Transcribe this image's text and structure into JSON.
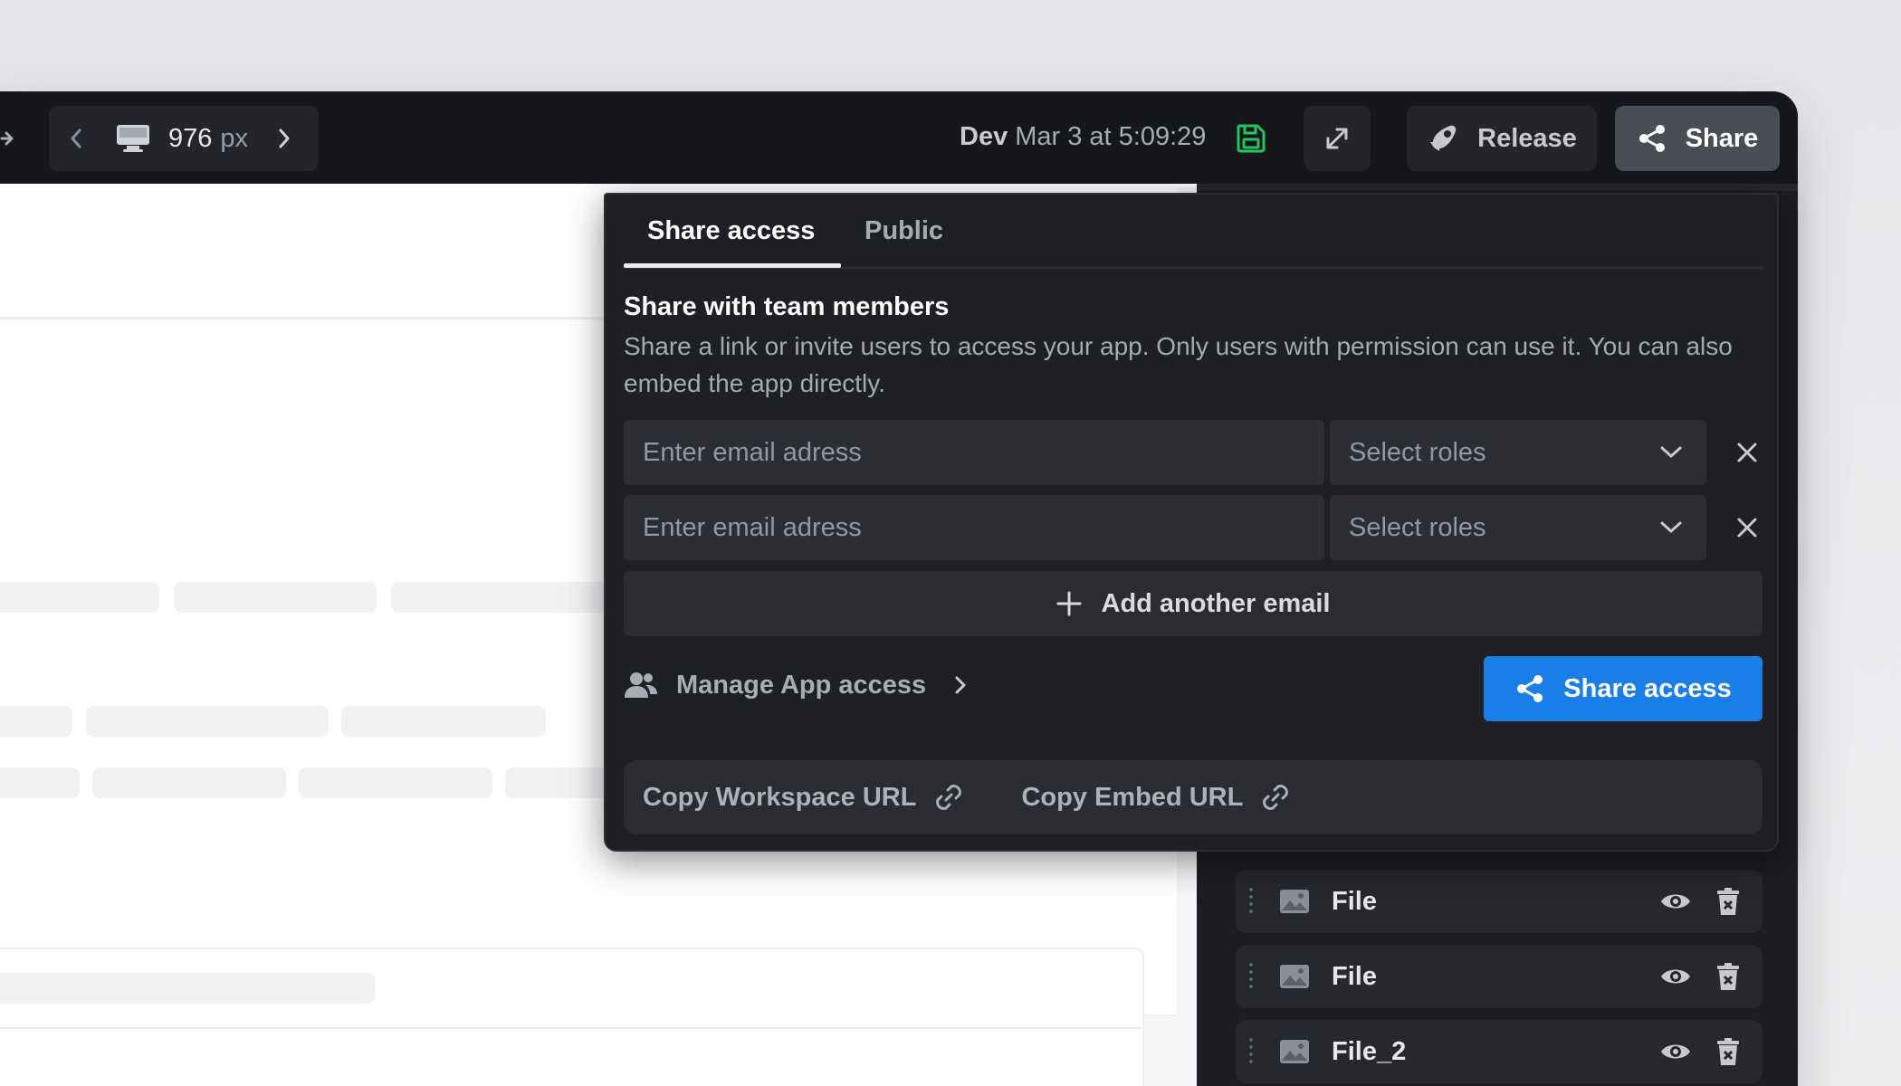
{
  "topbar": {
    "viewport_width_value": "976",
    "viewport_width_unit": "px",
    "env_label": "Dev",
    "saved_time": "Mar 3 at 5:09:29",
    "release_label": "Release",
    "share_label": "Share"
  },
  "share_popover": {
    "tabs": [
      {
        "label": "Share access",
        "active": true
      },
      {
        "label": "Public",
        "active": false
      }
    ],
    "section_title": "Share with team members",
    "section_desc": "Share a link or invite users to access your app. Only users with permission can use it. You can also embed the app directly.",
    "invite_rows": [
      {
        "email_placeholder": "Enter email adress",
        "role_placeholder": "Select roles"
      },
      {
        "email_placeholder": "Enter email adress",
        "role_placeholder": "Select roles"
      }
    ],
    "add_email_label": "Add another email",
    "manage_access_label": "Manage App access",
    "share_access_button": "Share access",
    "copy_workspace_url": "Copy Workspace URL",
    "copy_embed_url": "Copy Embed URL"
  },
  "right_panel": {
    "files": [
      {
        "label": "File"
      },
      {
        "label": "File"
      },
      {
        "label": "File_2"
      }
    ]
  },
  "colors": {
    "accent_blue": "#1a7ee8",
    "saved_green": "#22c55e",
    "panel_bg": "#1f2024",
    "topbar_bg": "#16171b"
  },
  "icons": {
    "viewport": "monitor-icon",
    "save_state": "save-icon",
    "expand": "expand-icon",
    "release": "rocket-icon",
    "share": "share-icon",
    "manage": "users-icon",
    "copy": "link-icon",
    "file_thumb": "image-icon",
    "visibility": "eye-icon",
    "delete": "trash-icon"
  }
}
